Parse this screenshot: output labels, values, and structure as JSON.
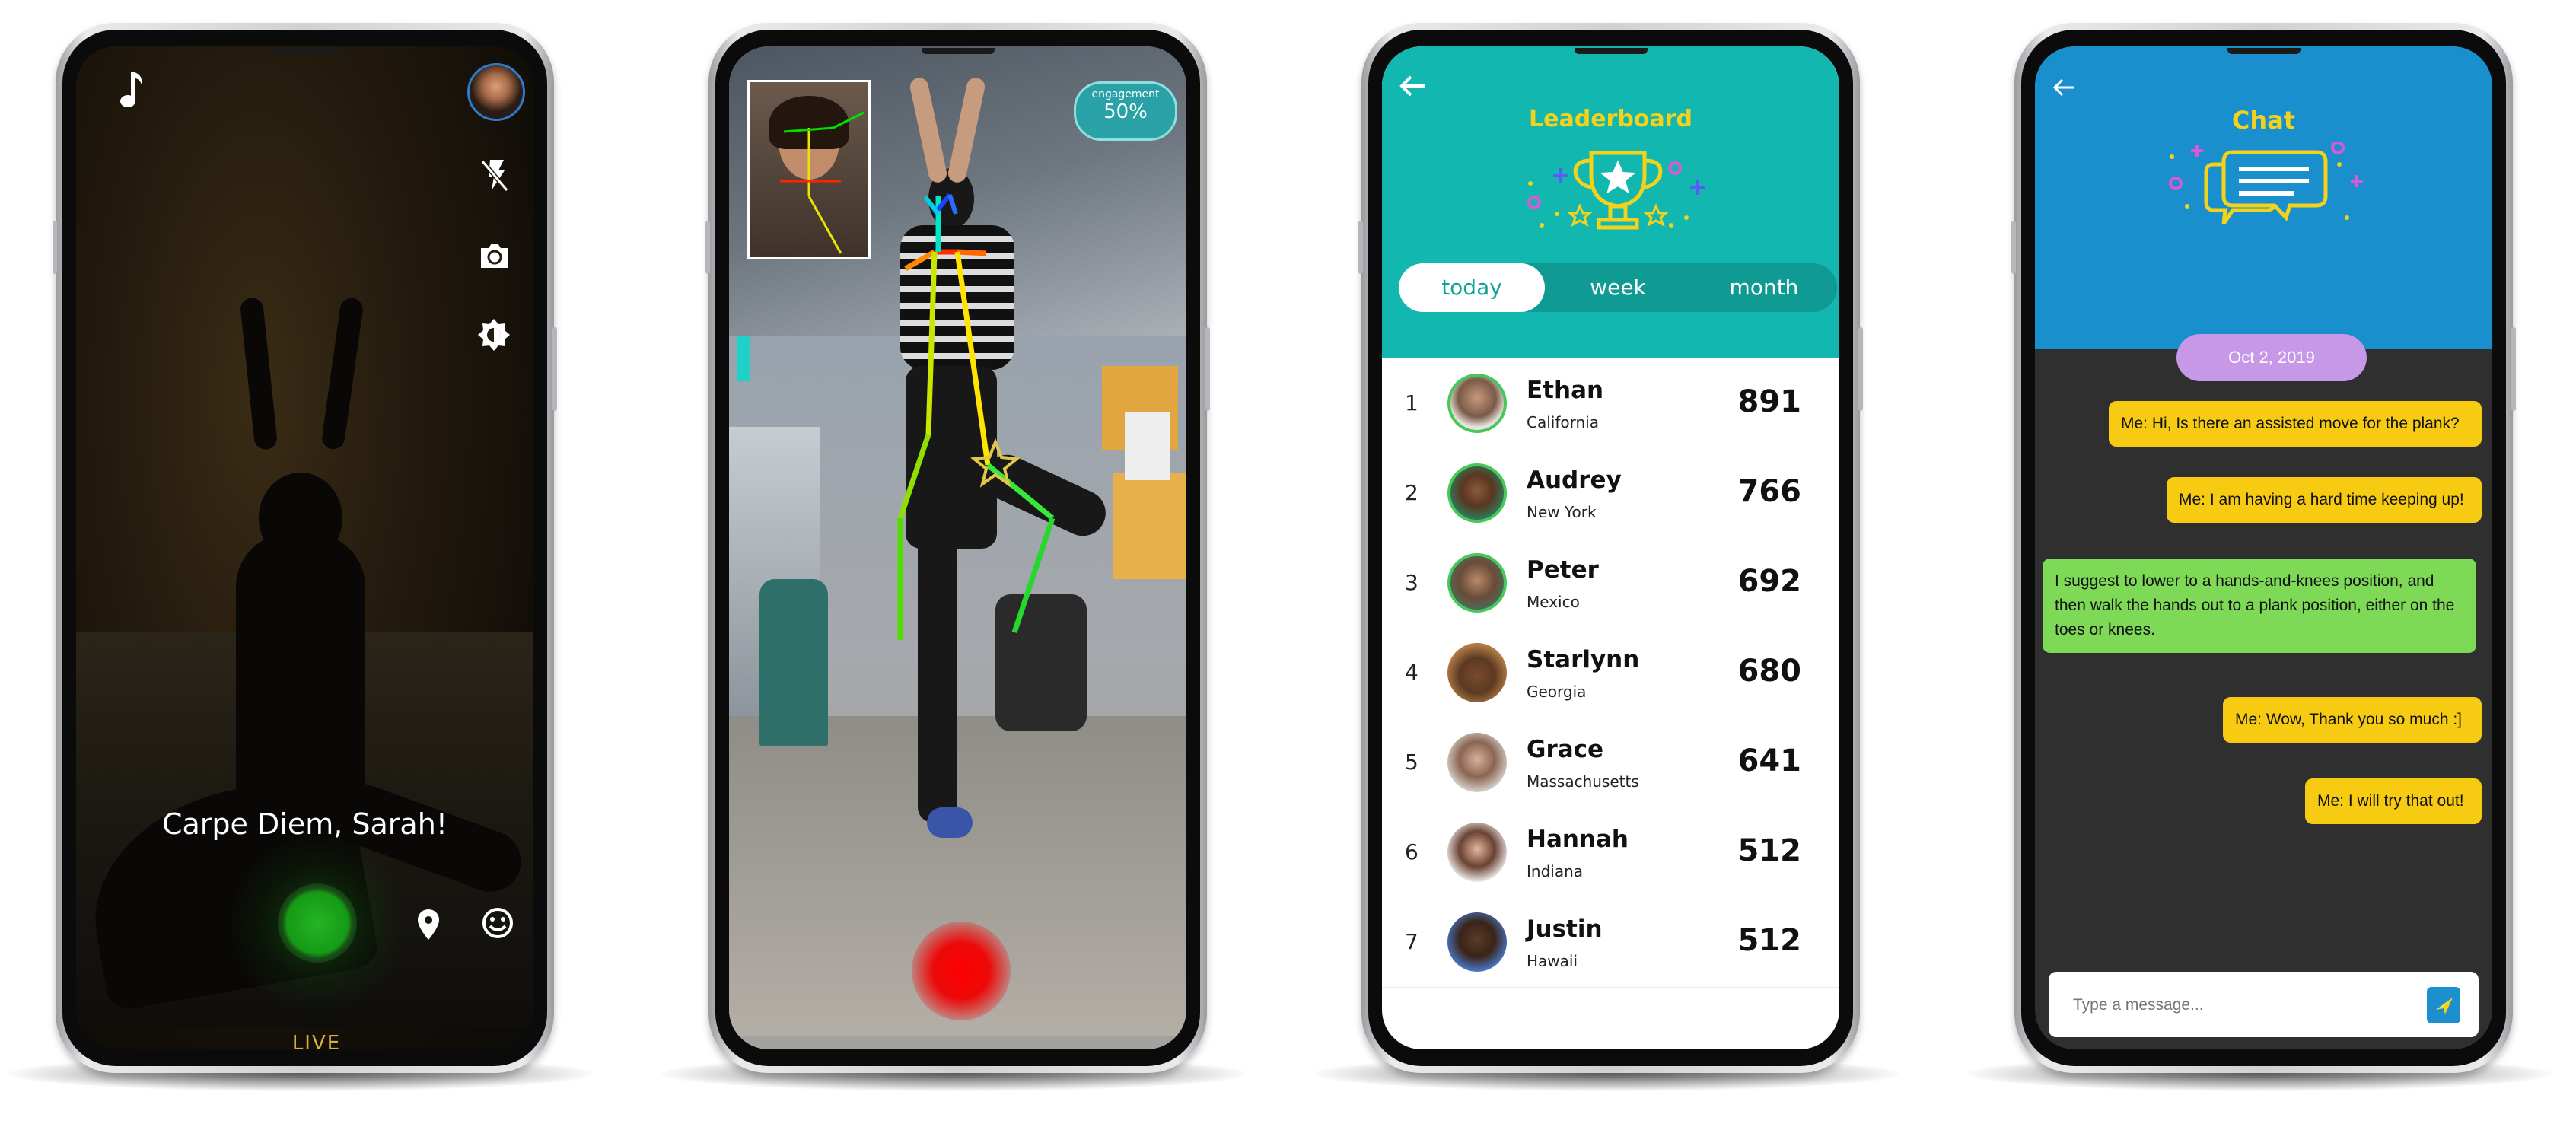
{
  "camera": {
    "greeting": "Carpe Diem, Sarah!",
    "mode_label": "LIVE",
    "icons": [
      "music-note-icon",
      "avatar",
      "flash-off-icon",
      "camera-flip-icon",
      "brightness-icon",
      "location-pin-icon",
      "emoji-icon"
    ]
  },
  "pose": {
    "engagement_label": "engagement",
    "engagement_value": "50%"
  },
  "leaderboard": {
    "title": "Leaderboard",
    "tabs": [
      "today",
      "week",
      "month"
    ],
    "active_tab": "today",
    "rows": [
      {
        "rank": "1",
        "name": "Ethan",
        "location": "California",
        "score": "891"
      },
      {
        "rank": "2",
        "name": "Audrey",
        "location": "New York",
        "score": "766"
      },
      {
        "rank": "3",
        "name": "Peter",
        "location": "Mexico",
        "score": "692"
      },
      {
        "rank": "4",
        "name": "Starlynn",
        "location": "Georgia",
        "score": "680"
      },
      {
        "rank": "5",
        "name": "Grace",
        "location": "Massachusetts",
        "score": "641"
      },
      {
        "rank": "6",
        "name": "Hannah",
        "location": "Indiana",
        "score": "512"
      },
      {
        "rank": "7",
        "name": "Justin",
        "location": "Hawaii",
        "score": "512"
      }
    ]
  },
  "chat": {
    "title": "Chat",
    "date": "Oct 2, 2019",
    "messages": [
      {
        "from": "me",
        "text": "Me: Hi, Is there an assisted move for the plank?"
      },
      {
        "from": "me",
        "text": "Me: I am having a hard time keeping up!"
      },
      {
        "from": "coach",
        "text": "I suggest to lower to a hands-and-knees position, and then walk the hands out to a plank position, either on the toes or knees."
      },
      {
        "from": "me",
        "text": "Me: Wow, Thank you so much :]"
      },
      {
        "from": "me",
        "text": "Me: I will try that out!"
      }
    ],
    "input_placeholder": "Type a message..."
  },
  "colors": {
    "teal": "#12b8b0",
    "chat_blue": "#1a8fce",
    "gold": "#f2d21a",
    "me_bubble": "#f8cb13",
    "coach_bubble": "#7ed957",
    "date_pill": "#c797e8"
  }
}
